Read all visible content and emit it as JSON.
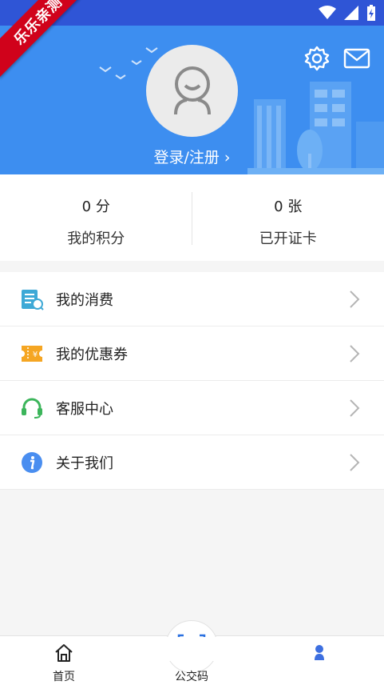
{
  "badge": {
    "text": "乐乐亲测"
  },
  "header": {
    "login_label": "登录/注册 ›",
    "icons": [
      "settings-icon",
      "mail-icon",
      "avatar-placeholder-icon"
    ]
  },
  "stats": [
    {
      "value": "0 分",
      "label": "我的积分"
    },
    {
      "value": "0 张",
      "label": "已开证卡"
    }
  ],
  "menu": [
    {
      "label": "我的消费",
      "icon": "consumption-icon"
    },
    {
      "label": "我的优惠券",
      "icon": "coupon-icon"
    },
    {
      "label": "客服中心",
      "icon": "headset-icon"
    },
    {
      "label": "关于我们",
      "icon": "info-icon"
    }
  ],
  "tabbar": [
    {
      "label": "首页",
      "icon": "home-icon"
    },
    {
      "label": "公交码",
      "icon": "barcode-icon"
    },
    {
      "label": "",
      "icon": "profile-icon"
    }
  ],
  "colors": {
    "status_bar": "#2f55d6",
    "header": "#3d8ef0",
    "badge": "#d0021b"
  }
}
